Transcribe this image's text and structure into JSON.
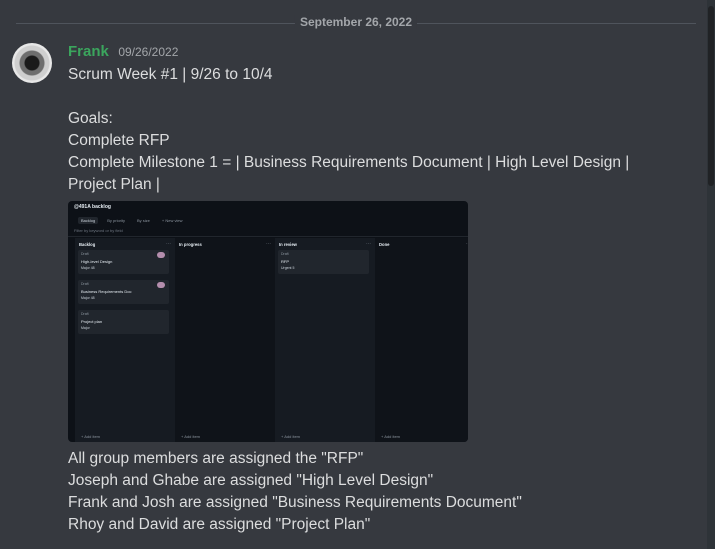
{
  "date_divider": "September 26, 2022",
  "author": {
    "name": "Frank",
    "timestamp": "09/26/2022",
    "name_color": "#3ba55d"
  },
  "message": {
    "lines": [
      "Scrum Week #1  |  9/26 to 10/4",
      "",
      "Goals:",
      "Complete RFP",
      "Complete Milestone 1 = | Business Requirements Document | High Level Design | Project Plan |"
    ],
    "after_lines": [
      "All group members are assigned the \"RFP\"",
      "Joseph and Ghabe are assigned \"High Level Design\"",
      "Frank and Josh are assigned \"Business Requirements Document\"",
      "Rhoy and David are assigned \"Project Plan\""
    ]
  },
  "attachment": {
    "title": "@491A backlog",
    "tabs": [
      "Backlog",
      "By priority",
      "By size",
      "+ New view"
    ],
    "filter_placeholder": "Filter by keyword or by field",
    "columns": [
      {
        "name": "Backlog",
        "cards": [
          {
            "meta": "Draft",
            "title": "High-level Design",
            "tag": "Major  48"
          },
          {
            "meta": "Draft",
            "title": "Business Requirements Doc",
            "tag": "Major  48"
          },
          {
            "meta": "Draft",
            "title": "Project plan",
            "tag": "Major"
          }
        ]
      },
      {
        "name": "In progress",
        "cards": []
      },
      {
        "name": "In review",
        "cards": [
          {
            "meta": "Draft",
            "title": "RFP",
            "tag": "Urgent  5"
          }
        ]
      },
      {
        "name": "Done",
        "cards": []
      }
    ],
    "add_item": "+ Add item"
  }
}
